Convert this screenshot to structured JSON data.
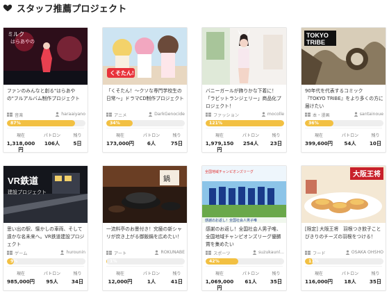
{
  "header": {
    "title": "スタッフ推薦プロジェクト"
  },
  "stats_labels": {
    "current": "現在",
    "patrons": "パトロン",
    "remaining": "残り"
  },
  "colors": {
    "progress_fill": "#f2c042",
    "progress_track": "#eeeeee",
    "heart": "#222222"
  },
  "projects": [
    {
      "title": "ファンのみんなと創る\"はらあやの\"フルアルバム制作プロジェクト",
      "category": "音楽",
      "owner": "haraaiyano",
      "percent_label": "87%",
      "progress": 0.87,
      "current": "1,318,000円",
      "patrons": "106人",
      "remaining": "5日"
    },
    {
      "title": "「くそたん！〜クソな専門学校生の日常〜」ドラマCD制作プロジェクト",
      "category": "アニメ",
      "owner": "DarkGenocide",
      "percent_label": "34%",
      "progress": 0.34,
      "current": "173,000円",
      "patrons": "6人",
      "remaining": "75日"
    },
    {
      "title": "バニーガールが飾りかな下着に！「ラビットランジェリー」商品化プロジェクト！",
      "category": "ファッション",
      "owner": "mocolle",
      "percent_label": "121%",
      "progress": 1.0,
      "current": "1,979,150円",
      "patrons": "254人",
      "remaining": "23日"
    },
    {
      "title": "90年代を代表するコミック『TOKYO TRIBE』をより多くの方に届けたい",
      "category": "本・漫画",
      "owner": "santainoue",
      "percent_label": "36%",
      "progress": 0.36,
      "current": "399,600円",
      "patrons": "54人",
      "remaining": "10日"
    },
    {
      "title": "思い出の駅、懐かしの車両、そして遠かな名未来へ。VR鉄道建設プロジェクト",
      "category": "ゲーム",
      "owner": "hurounin",
      "percent_label": "9%",
      "progress": 0.09,
      "current": "985,000円",
      "patrons": "95人",
      "remaining": "34日"
    },
    {
      "title": "一流料亭のお墨付き！究極の新シャリが炊き上がる御飯鍋を広めたい！",
      "category": "アート",
      "owner": "ROKUNABE",
      "percent_label": "1%",
      "progress": 0.01,
      "current": "12,000円",
      "patrons": "1人",
      "remaining": "41日"
    },
    {
      "title": "感謝のお返し！全国社会人男子唯、全国地域チャンピオンズリーグ優勝賞を集めたい",
      "category": "スポーツ",
      "owner": "suzukaunl...",
      "percent_label": "42%",
      "progress": 0.42,
      "current": "1,069,000円",
      "patrons": "61人",
      "remaining": "35日"
    },
    {
      "title": "[限定] 大阪王将　羽根つき餃子ことびきりのチーズの羽根をつける！",
      "category": "フード",
      "owner": "OSAKA OHSHO",
      "percent_label": "11%",
      "progress": 0.11,
      "current": "116,000円",
      "patrons": "18人",
      "remaining": "35日"
    }
  ]
}
